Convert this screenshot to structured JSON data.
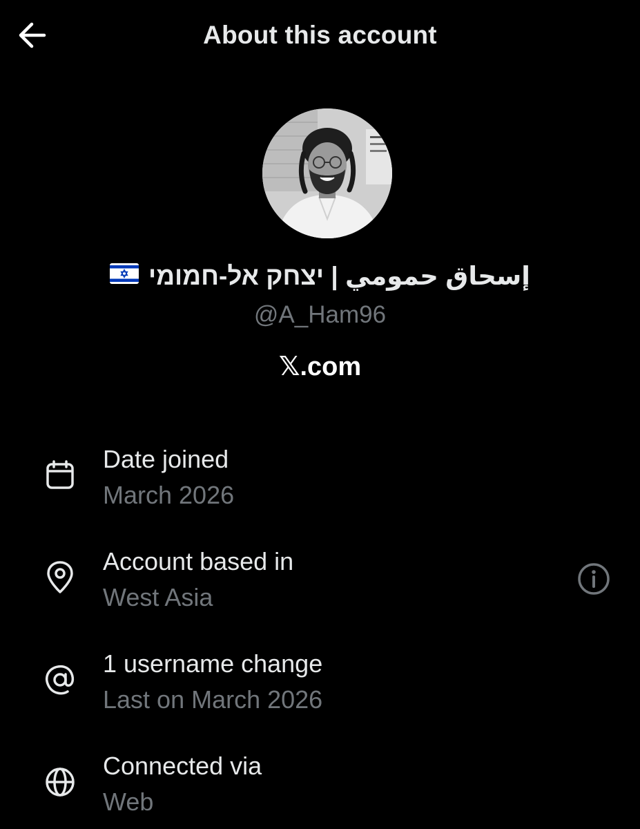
{
  "header": {
    "title": "About this account",
    "back_icon": "arrow-left-icon"
  },
  "profile": {
    "display_name": "إسحاق حمومي | יצחק אל-חמומי",
    "flag_icon": "israel-flag-icon",
    "handle": "@A_Ham96",
    "site": "𝕏.com"
  },
  "details": [
    {
      "icon": "calendar-icon",
      "label": "Date joined",
      "value": "March 2026"
    },
    {
      "icon": "location-pin-icon",
      "label": "Account based in",
      "value": "West Asia",
      "info_icon": "info-circle-icon"
    },
    {
      "icon": "at-sign-icon",
      "label": "1 username change",
      "value": "Last on March 2026"
    },
    {
      "icon": "globe-icon",
      "label": "Connected via",
      "value": "Web"
    }
  ],
  "colors": {
    "background": "#000000",
    "primary_text": "#e7e9ea",
    "secondary_text": "#71767b",
    "flag_blue": "#0038b8"
  }
}
